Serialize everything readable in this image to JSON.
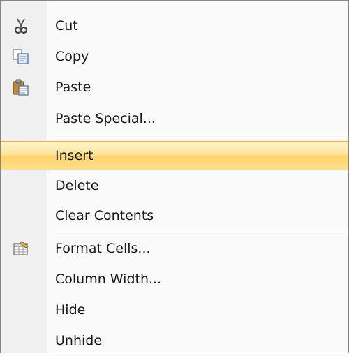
{
  "menu": {
    "items": [
      {
        "label": "Cut",
        "icon": "scissors-icon"
      },
      {
        "label": "Copy",
        "icon": "copy-icon"
      },
      {
        "label": "Paste",
        "icon": "paste-icon"
      },
      {
        "label": "Paste Special..."
      },
      {
        "label": "Insert",
        "highlighted": true
      },
      {
        "label": "Delete"
      },
      {
        "label": "Clear Contents"
      },
      {
        "label": "Format Cells...",
        "icon": "format-cells-icon"
      },
      {
        "label": "Column Width..."
      },
      {
        "label": "Hide"
      },
      {
        "label": "Unhide"
      }
    ]
  },
  "colors": {
    "highlight": "#ffd46a",
    "gutter": "#f0f0f0",
    "border": "#868686"
  }
}
